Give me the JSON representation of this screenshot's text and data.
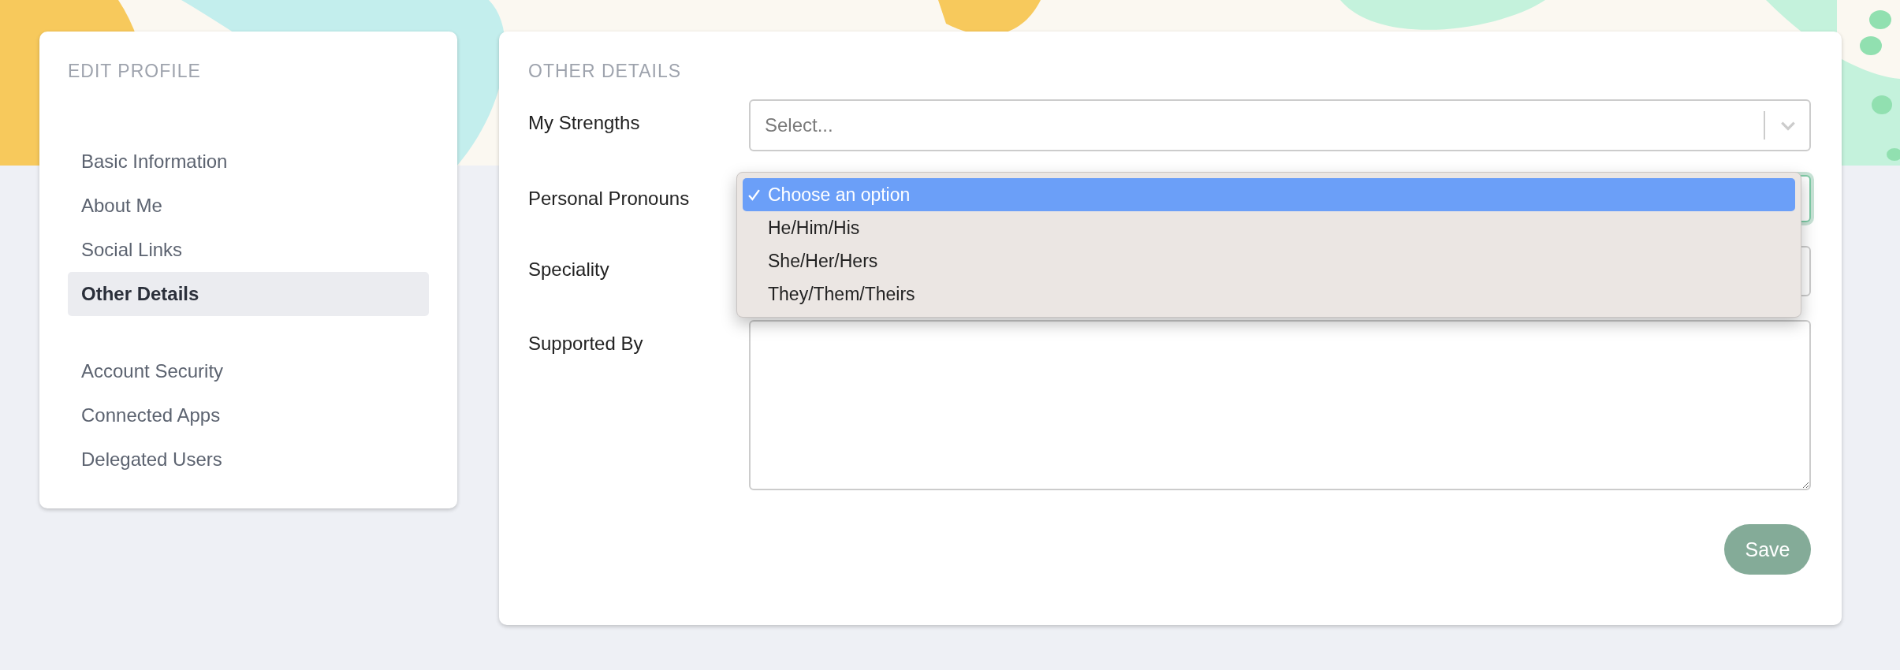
{
  "sidebar": {
    "title": "EDIT PROFILE",
    "groups": [
      [
        {
          "label": "Basic Information",
          "selected": false
        },
        {
          "label": "About Me",
          "selected": false
        },
        {
          "label": "Social Links",
          "selected": false
        },
        {
          "label": "Other Details",
          "selected": true
        }
      ],
      [
        {
          "label": "Account Security",
          "selected": false
        },
        {
          "label": "Connected Apps",
          "selected": false
        },
        {
          "label": "Delegated Users",
          "selected": false
        }
      ]
    ]
  },
  "main": {
    "title": "OTHER DETAILS",
    "fields": [
      {
        "label": "My Strengths",
        "kind": "select",
        "placeholder": "Select..."
      },
      {
        "label": "Personal Pronouns",
        "kind": "native-select",
        "focused": true,
        "options": [
          {
            "label": "Choose an option",
            "selected": true
          },
          {
            "label": "He/Him/His",
            "selected": false
          },
          {
            "label": "She/Her/Hers",
            "selected": false
          },
          {
            "label": "They/Them/Theirs",
            "selected": false
          }
        ]
      },
      {
        "label": "Speciality",
        "kind": "input"
      },
      {
        "label": "Supported By",
        "kind": "textarea"
      }
    ],
    "button": "Save"
  }
}
